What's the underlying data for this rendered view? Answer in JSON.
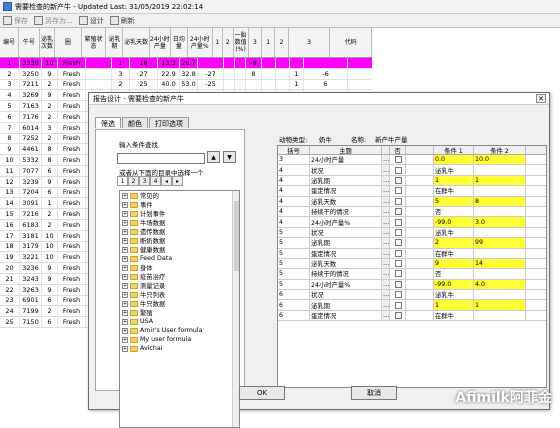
{
  "window": {
    "title": "需要检查的新产牛 - Updated Last: 31/05/2019 22:02:14"
  },
  "toolbar": {
    "save": "保存",
    "save_as": "另存为...",
    "design": "设计",
    "refresh": "刷新"
  },
  "grid": {
    "headers": [
      "编号",
      "牛号",
      "泌乳次数",
      "圈",
      "繁殖状态",
      "泌乳期",
      "泌乳天数",
      "24小时产量",
      "日均量",
      "24小时产量%",
      "1",
      "2",
      "一胎数值(%)",
      "3",
      "1",
      "2",
      "3",
      "代码"
    ],
    "rows": [
      [
        "1",
        "3330",
        "10",
        "Fresh",
        "",
        "1",
        "18",
        "13.3",
        "26.7",
        "",
        "",
        "",
        "-8",
        "",
        "",
        "",
        "",
        ""
      ],
      [
        "2",
        "3250",
        "9",
        "Fresh",
        "",
        "3",
        "27",
        "22.9",
        "32.8",
        "-27",
        "",
        "",
        "8",
        "",
        "",
        "1",
        "-6",
        ""
      ],
      [
        "3",
        "7211",
        "2",
        "Fresh",
        "",
        "2",
        "25",
        "40.0",
        "53.0",
        "-25",
        "",
        "",
        "",
        "",
        "",
        "1",
        "6",
        ""
      ],
      [
        "4",
        "3269",
        "9",
        "Fresh",
        "",
        "",
        "",
        "",
        "",
        "",
        "",
        "",
        "",
        "",
        "",
        "",
        "",
        ""
      ],
      [
        "5",
        "7163",
        "2",
        "Fresh",
        "",
        "",
        "",
        "",
        "",
        "",
        "",
        "",
        "",
        "",
        "",
        "",
        "",
        ""
      ],
      [
        "6",
        "7176",
        "2",
        "Fresh",
        "",
        "",
        "",
        "",
        "",
        "",
        "",
        "",
        "",
        "",
        "",
        "",
        "",
        ""
      ],
      [
        "7",
        "6014",
        "3",
        "Fresh",
        "",
        "",
        "",
        "",
        "",
        "",
        "",
        "",
        "",
        "",
        "",
        "",
        "",
        ""
      ],
      [
        "8",
        "7252",
        "2",
        "Fresh",
        "",
        "",
        "",
        "",
        "",
        "",
        "",
        "",
        "",
        "",
        "",
        "",
        "",
        ""
      ],
      [
        "9",
        "4461",
        "8",
        "Fresh",
        "",
        "",
        "",
        "",
        "",
        "",
        "",
        "",
        "",
        "",
        "",
        "",
        "",
        ""
      ],
      [
        "10",
        "5332",
        "8",
        "Fresh",
        "",
        "",
        "",
        "",
        "",
        "",
        "",
        "",
        "",
        "",
        "",
        "",
        "",
        ""
      ],
      [
        "11",
        "7077",
        "6",
        "Fresh",
        "",
        "",
        "",
        "",
        "",
        "",
        "",
        "",
        "",
        "",
        "",
        "",
        "",
        ""
      ],
      [
        "12",
        "3239",
        "9",
        "Fresh",
        "",
        "",
        "",
        "",
        "",
        "",
        "",
        "",
        "",
        "",
        "",
        "",
        "",
        ""
      ],
      [
        "13",
        "7204",
        "6",
        "Fresh",
        "",
        "",
        "",
        "",
        "",
        "",
        "",
        "",
        "",
        "",
        "",
        "",
        "",
        ""
      ],
      [
        "14",
        "3091",
        "1",
        "Fresh",
        "",
        "",
        "",
        "",
        "",
        "",
        "",
        "",
        "",
        "",
        "",
        "",
        "",
        ""
      ],
      [
        "15",
        "7216",
        "2",
        "Fresh",
        "",
        "",
        "",
        "",
        "",
        "",
        "",
        "",
        "",
        "",
        "",
        "",
        "",
        ""
      ],
      [
        "16",
        "6183",
        "2",
        "Fresh",
        "",
        "",
        "",
        "",
        "",
        "",
        "",
        "",
        "",
        "",
        "",
        "",
        "",
        ""
      ],
      [
        "17",
        "3181",
        "10",
        "Fresh",
        "",
        "",
        "",
        "",
        "",
        "",
        "",
        "",
        "",
        "",
        "",
        "",
        "",
        ""
      ],
      [
        "18",
        "3179",
        "10",
        "Fresh",
        "",
        "",
        "",
        "",
        "",
        "",
        "",
        "",
        "",
        "",
        "",
        "",
        "",
        ""
      ],
      [
        "19",
        "3221",
        "10",
        "Fresh",
        "",
        "",
        "",
        "",
        "",
        "",
        "",
        "",
        "",
        "",
        "",
        "",
        "",
        ""
      ],
      [
        "20",
        "3236",
        "9",
        "Fresh",
        "",
        "",
        "",
        "",
        "",
        "",
        "",
        "",
        "",
        "",
        "",
        "",
        "",
        ""
      ],
      [
        "21",
        "3243",
        "9",
        "Fresh",
        "",
        "",
        "",
        "",
        "",
        "",
        "",
        "",
        "",
        "",
        "",
        "",
        "",
        ""
      ],
      [
        "22",
        "3263",
        "9",
        "Fresh",
        "",
        "",
        "",
        "",
        "",
        "",
        "",
        "",
        "",
        "",
        "",
        "",
        "",
        ""
      ],
      [
        "23",
        "6901",
        "6",
        "Fresh",
        "",
        "",
        "",
        "",
        "",
        "",
        "",
        "",
        "",
        "",
        "",
        "",
        "",
        ""
      ],
      [
        "24",
        "7199",
        "2",
        "Fresh",
        "",
        "",
        "",
        "",
        "",
        "",
        "",
        "",
        "",
        "",
        "",
        "",
        "",
        ""
      ],
      [
        "25",
        "7150",
        "6",
        "Fresh",
        "",
        "",
        "",
        "",
        "",
        "",
        "",
        "",
        "",
        "",
        "",
        "",
        "",
        ""
      ]
    ]
  },
  "dialog": {
    "title": "报告设计 - 需要检查的新产牛",
    "tabs": [
      "筛选",
      "颜色",
      "打印选项"
    ],
    "input_label": "输入条件查找",
    "select_label": "或者从下面的目录中选择一个",
    "left_tabs": [
      "1",
      "2",
      "3",
      "4"
    ],
    "tree": [
      "常见的",
      "事件",
      "计划事件",
      "牛场数据",
      "遗传数据",
      "断奶数据",
      "健康数据",
      "Feed Data",
      "身体",
      "疫苗治疗",
      "测量记录",
      "牛只列表",
      "牛只数据",
      "繁殖",
      "USA",
      "Amir's User formula",
      "My user formula",
      "Avichai"
    ],
    "right_header": {
      "type_label": "动物类型:",
      "type_value": "奶牛",
      "name_label": "名称:",
      "name_value": "新产牛产量"
    },
    "right_cols": [
      "括号",
      "主题",
      "",
      "否",
      "",
      "条件 1",
      "条件 2"
    ],
    "right_rows": [
      [
        "3",
        "24小时产量",
        "",
        "",
        "",
        "0.0",
        "10.0"
      ],
      [
        "4",
        "状况",
        "",
        "",
        "",
        "泌乳牛",
        ""
      ],
      [
        "4",
        "泌乳期",
        "",
        "",
        "",
        "1",
        "1"
      ],
      [
        "4",
        "蛋定情况",
        "",
        "",
        "",
        "在群牛",
        ""
      ],
      [
        "4",
        "泌乳天数",
        "",
        "",
        "",
        "5",
        "8"
      ],
      [
        "4",
        "持续干的情况",
        "",
        "",
        "",
        "否",
        ""
      ],
      [
        "4",
        "24小时产量%",
        "",
        "",
        "",
        "-99.0",
        "3.0"
      ],
      [
        "5",
        "状况",
        "",
        "",
        "",
        "泌乳牛",
        ""
      ],
      [
        "5",
        "泌乳期",
        "",
        "",
        "",
        "2",
        "99"
      ],
      [
        "5",
        "蛋定情况",
        "",
        "",
        "",
        "在群牛",
        ""
      ],
      [
        "5",
        "泌乳天数",
        "",
        "",
        "",
        "9",
        "14"
      ],
      [
        "5",
        "持续干的情况",
        "",
        "",
        "",
        "否",
        ""
      ],
      [
        "5",
        "24小时产量%",
        "",
        "",
        "",
        "-99.0",
        "4.0"
      ],
      [
        "6",
        "状况",
        "",
        "",
        "",
        "泌乳牛",
        ""
      ],
      [
        "6",
        "泌乳期",
        "",
        "",
        "",
        "1",
        "1"
      ],
      [
        "6",
        "蛋定情况",
        "",
        "",
        "",
        "在群牛",
        ""
      ]
    ],
    "ok": "OK",
    "cancel": "取消"
  },
  "watermark": "Afimilk阿菲金"
}
